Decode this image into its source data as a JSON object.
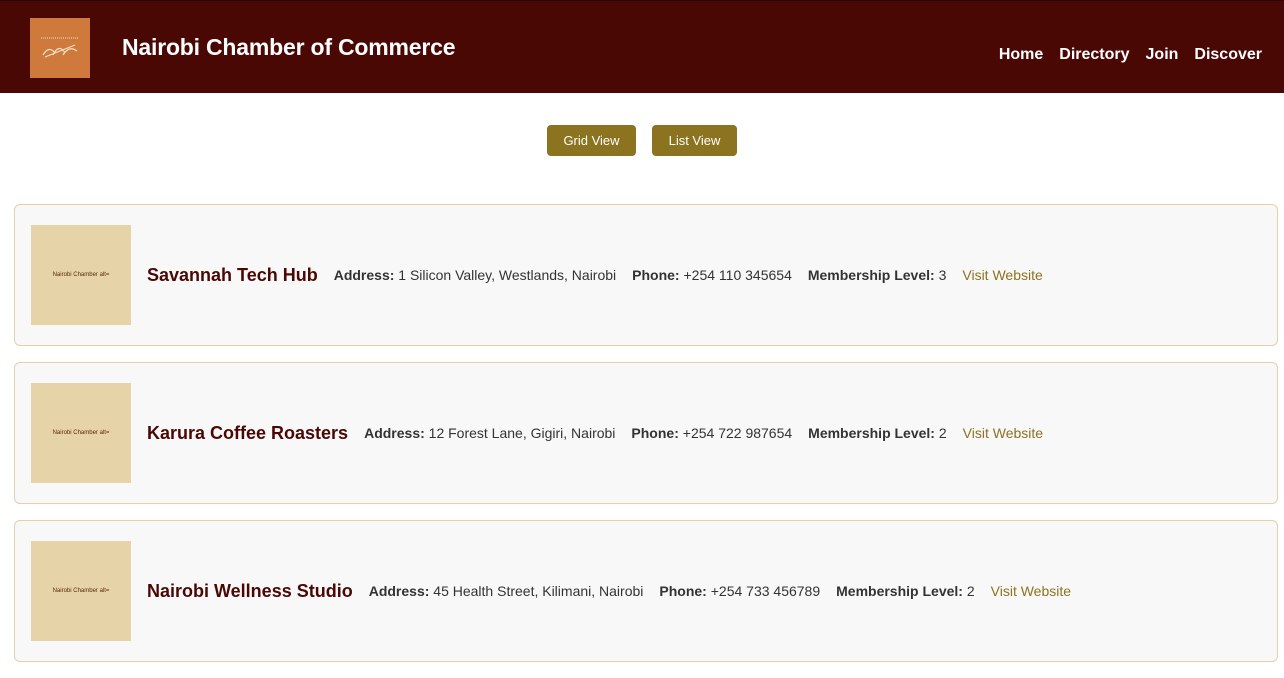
{
  "header": {
    "title": "Nairobi Chamber of Commerce",
    "logo_icon": "chamber-logo-icon",
    "nav": [
      "Home",
      "Directory",
      "Join",
      "Discover"
    ]
  },
  "view_toggle": {
    "grid_label": "Grid View",
    "list_label": "List View"
  },
  "labels": {
    "address": "Address:",
    "phone": "Phone:",
    "membership": "Membership Level:",
    "visit": "Visit Website",
    "image_alt": "Nairobi Chamber alt="
  },
  "members": [
    {
      "name": "Savannah Tech Hub",
      "address": "1 Silicon Valley, Westlands, Nairobi",
      "phone": "+254 110 345654",
      "membership_level": "3"
    },
    {
      "name": "Karura Coffee Roasters",
      "address": "12 Forest Lane, Gigiri, Nairobi",
      "phone": "+254 722 987654",
      "membership_level": "2"
    },
    {
      "name": "Nairobi Wellness Studio",
      "address": "45 Health Street, Kilimani, Nairobi",
      "phone": "+254 733 456789",
      "membership_level": "2"
    }
  ],
  "colors": {
    "header_bg": "#4a0804",
    "accent": "#8b7320",
    "logo_bg": "#cf7a3c",
    "card_border": "#e6cfa9"
  }
}
